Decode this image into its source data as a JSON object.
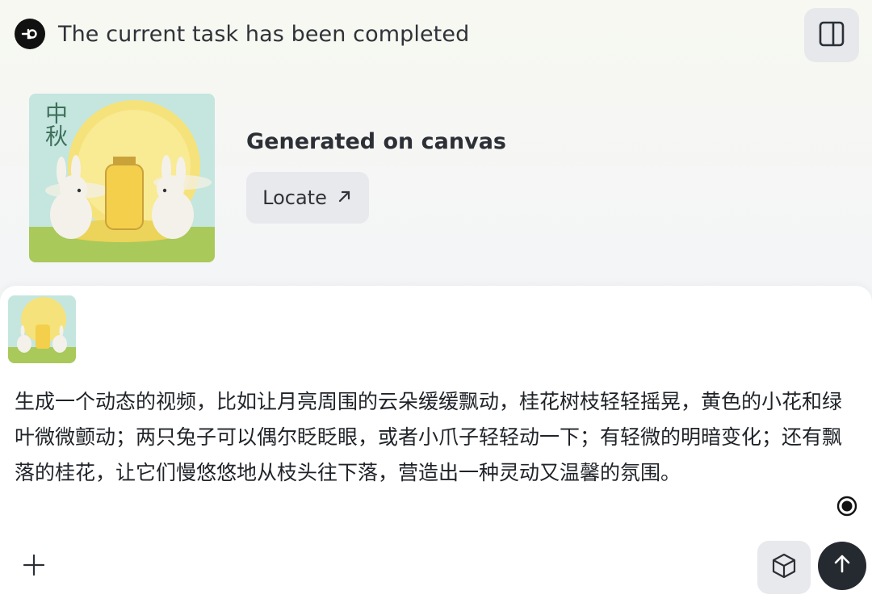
{
  "header": {
    "status": "The current task has been completed",
    "logo_icon": "loop-logo-icon",
    "panel_icon": "sidebar-panel-icon"
  },
  "result": {
    "thumbnail_title_text": "中秋",
    "title": "Generated on canvas",
    "locate_label": "Locate",
    "locate_icon": "arrow-up-right-icon"
  },
  "composer": {
    "prompt": "生成一个动态的视频，比如让月亮周围的云朵缓缓飘动，桂花树枝轻轻摇晃，黄色的小花和绿叶微微颤动；两只兔子可以偶尔眨眨眼，或者小爪子轻轻动一下；有轻微的明暗变化；还有飘落的桂花，让它们慢悠悠地从枝头往下落，营造出一种灵动又温馨的氛围。",
    "add_icon": "plus-icon",
    "model_icon": "cube-icon",
    "send_icon": "arrow-up-icon"
  },
  "colors": {
    "send_button": "#252a30",
    "secondary_button": "#e8e9ec",
    "moon": "#f6e27a",
    "sky": "#bfe3dc"
  }
}
